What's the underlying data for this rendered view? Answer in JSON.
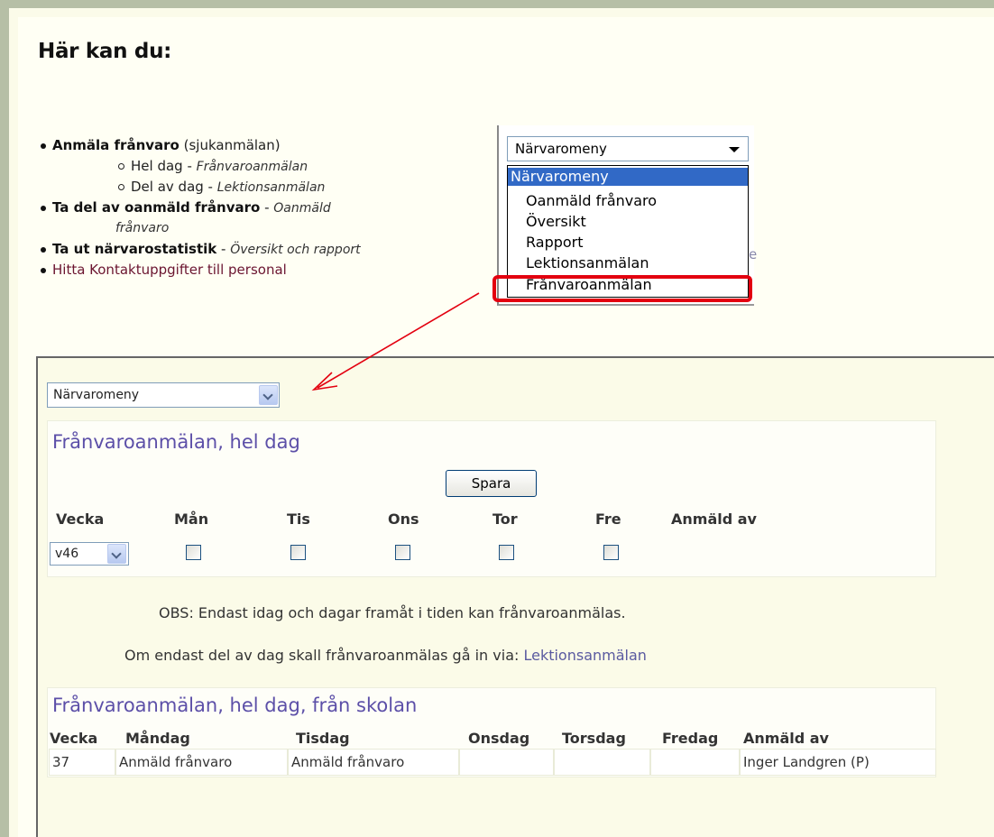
{
  "heading": "Här kan du:",
  "bullets": {
    "item1_bold": "Anmäla frånvaro",
    "item1_rest": " (sjukanmälan)",
    "sub1_text": "Hel dag - ",
    "sub1_italic": "Frånvaroanmälan",
    "sub2_text": "Del av dag - ",
    "sub2_italic": "Lektionsanmälan",
    "item2_bold": "Ta del av oanmäld frånvaro",
    "item2_dash": " - ",
    "item2_italic_a": "Oanmäld",
    "item2_italic_b": "frånvaro",
    "item3_bold": "Ta ut närvarostatistik",
    "item3_dash": " - ",
    "item3_italic": "Översikt och rapport",
    "item4_text": "Hitta Kontaktuppgifter till personal"
  },
  "top_dropdown": {
    "selected": "Närvaromeny",
    "options": [
      "Närvaromeny",
      "Oanmäld frånvaro",
      "Översikt",
      "Rapport",
      "Lektionsanmälan",
      "Frånvaroanmälan"
    ],
    "fragment": "e"
  },
  "menu_select": {
    "selected": "Närvaromeny"
  },
  "section1": {
    "title": "Frånvaroanmälan, hel dag",
    "save_label": "Spara",
    "headers": [
      "Vecka",
      "Mån",
      "Tis",
      "Ons",
      "Tor",
      "Fre",
      "Anmäld av"
    ],
    "week_value": "v46",
    "note1": "OBS: Endast idag och dagar framåt i tiden kan frånvaroanmälas.",
    "note2_text": "Om endast del av dag skall frånvaroanmälas gå in via: ",
    "note2_link": "Lektionsanmälan"
  },
  "section2": {
    "title": "Frånvaroanmälan, hel dag, från skolan",
    "headers": [
      "Vecka",
      "Måndag",
      "Tisdag",
      "Onsdag",
      "Torsdag",
      "Fredag",
      "Anmäld av"
    ],
    "rows": [
      [
        "37",
        "Anmäld frånvaro",
        "Anmäld frånvaro",
        "",
        "",
        "",
        "Inger Landgren (P)"
      ]
    ]
  },
  "colors": {
    "highlight": "#e3000f",
    "title": "#5c4fa8",
    "selection": "#3169c6"
  }
}
